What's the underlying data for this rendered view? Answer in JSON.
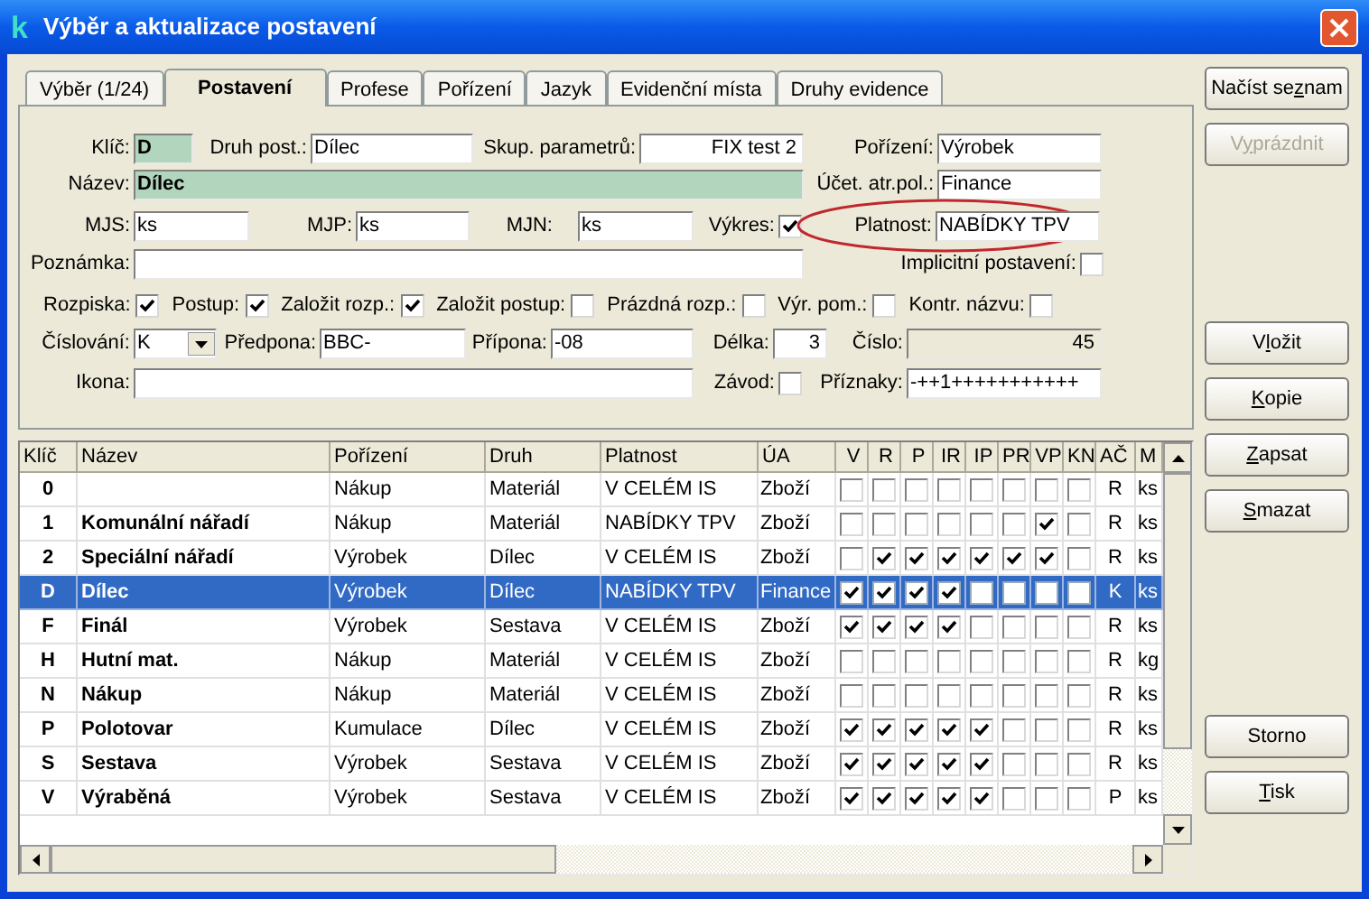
{
  "window": {
    "title": "Výběr a aktualizace postavení",
    "icon_letter": "k"
  },
  "tabs": [
    {
      "label": "Výběr (1/24)",
      "selected": false
    },
    {
      "label": "Postavení",
      "selected": true
    },
    {
      "label": "Profese",
      "selected": false
    },
    {
      "label": "Pořízení",
      "selected": false
    },
    {
      "label": "Jazyk",
      "selected": false
    },
    {
      "label": "Evidenční místa",
      "selected": false
    },
    {
      "label": "Druhy evidence",
      "selected": false
    }
  ],
  "form": {
    "klic": {
      "label": "Klíč:",
      "value": "D"
    },
    "druh_post": {
      "label": "Druh post.:",
      "value": "Dílec"
    },
    "skup_parametru": {
      "label": "Skup. parametrů:",
      "value": "FIX test 2"
    },
    "porizeni": {
      "label": "Pořízení:",
      "value": "Výrobek"
    },
    "nazev": {
      "label": "Název:",
      "value": "Dílec"
    },
    "ucet_atr_pol": {
      "label": "Účet. atr.pol.:",
      "value": "Finance"
    },
    "mjs": {
      "label": "MJS:",
      "value": "ks"
    },
    "mjp": {
      "label": "MJP:",
      "value": "ks"
    },
    "mjn": {
      "label": "MJN:",
      "value": "ks"
    },
    "vykres": {
      "label": "Výkres:",
      "checked": true
    },
    "platnost": {
      "label": "Platnost:",
      "value": "NABÍDKY TPV"
    },
    "poznamka": {
      "label": "Poznámka:"
    },
    "implicitni_postaveni": {
      "label": "Implicitní postavení:",
      "checked": false
    },
    "flags": [
      {
        "label": "Rozpiska:",
        "checked": true
      },
      {
        "label": "Postup:",
        "checked": true
      },
      {
        "label": "Založit rozp.:",
        "checked": true
      },
      {
        "label": "Založit postup:",
        "checked": false
      },
      {
        "label": "Prázdná rozp.:",
        "checked": false
      },
      {
        "label": "Výr. pom.:",
        "checked": false
      },
      {
        "label": "Kontr. názvu:",
        "checked": false
      }
    ],
    "cislovani": {
      "label": "Číslování:",
      "value": "K"
    },
    "predpona": {
      "label": "Předpona:",
      "value": "BBC-"
    },
    "pripona": {
      "label": "Přípona:",
      "value": "-08"
    },
    "delka": {
      "label": "Délka:",
      "value": "3"
    },
    "cislo": {
      "label": "Číslo:",
      "value": "45"
    },
    "ikona": {
      "label": "Ikona:"
    },
    "zavod": {
      "label": "Závod:",
      "checked": false
    },
    "priznaky": {
      "label": "Příznaky:",
      "value": "-++1+++++++++++"
    }
  },
  "table": {
    "columns": [
      "Klíč",
      "Název",
      "Pořízení",
      "Druh",
      "Platnost",
      "ÚA",
      "V",
      "R",
      "P",
      "IR",
      "IP",
      "PR",
      "VP",
      "KN",
      "AČ",
      "M"
    ],
    "rows": [
      {
        "key": "0",
        "porizeni": "Nákup",
        "druh": "Materiál",
        "platnost": "V CELÉM IS",
        "ua": "Zboží",
        "flags": [
          {
            "checked": false
          },
          {
            "checked": false
          },
          {
            "checked": false
          },
          {
            "checked": false
          },
          {
            "checked": false
          },
          {
            "checked": false
          },
          {
            "checked": false
          },
          {
            "checked": false
          }
        ],
        "ac": "R",
        "m": "ks",
        "selected": false
      },
      {
        "key": "1",
        "name": "Komunální nářadí",
        "porizeni": "Nákup",
        "druh": "Materiál",
        "platnost": "NABÍDKY TPV",
        "ua": "Zboží",
        "flags": [
          {
            "checked": false
          },
          {
            "checked": false
          },
          {
            "checked": false
          },
          {
            "checked": false
          },
          {
            "checked": false
          },
          {
            "checked": false
          },
          {
            "checked": true
          },
          {
            "checked": false
          }
        ],
        "ac": "R",
        "m": "ks",
        "selected": false
      },
      {
        "key": "2",
        "name": "Speciální nářadí",
        "porizeni": "Výrobek",
        "druh": "Dílec",
        "platnost": "V CELÉM IS",
        "ua": "Zboží",
        "flags": [
          {
            "checked": false
          },
          {
            "checked": true
          },
          {
            "checked": true
          },
          {
            "checked": true
          },
          {
            "checked": true
          },
          {
            "checked": true
          },
          {
            "checked": true
          },
          {
            "checked": false
          }
        ],
        "ac": "R",
        "m": "ks",
        "selected": false
      },
      {
        "key": "D",
        "name": "Dílec",
        "porizeni": "Výrobek",
        "druh": "Dílec",
        "platnost": "NABÍDKY TPV",
        "ua": "Finance",
        "flags": [
          {
            "checked": true
          },
          {
            "checked": true
          },
          {
            "checked": true
          },
          {
            "checked": true
          },
          {
            "checked": false
          },
          {
            "checked": false
          },
          {
            "checked": false
          },
          {
            "checked": false
          }
        ],
        "ac": "K",
        "m": "ks",
        "selected": true
      },
      {
        "key": "F",
        "name": "Finál",
        "porizeni": "Výrobek",
        "druh": "Sestava",
        "platnost": "V CELÉM IS",
        "ua": "Zboží",
        "flags": [
          {
            "checked": true
          },
          {
            "checked": true
          },
          {
            "checked": true
          },
          {
            "checked": true
          },
          {
            "checked": false
          },
          {
            "checked": false
          },
          {
            "checked": false
          },
          {
            "checked": false
          }
        ],
        "ac": "R",
        "m": "ks",
        "selected": false
      },
      {
        "key": "H",
        "name": "Hutní mat.",
        "porizeni": "Nákup",
        "druh": "Materiál",
        "platnost": "V CELÉM IS",
        "ua": "Zboží",
        "flags": [
          {
            "checked": false
          },
          {
            "checked": false
          },
          {
            "checked": false
          },
          {
            "checked": false
          },
          {
            "checked": false
          },
          {
            "checked": false
          },
          {
            "checked": false
          },
          {
            "checked": false
          }
        ],
        "ac": "R",
        "m": "kg",
        "selected": false
      },
      {
        "key": "N",
        "name": "Nákup",
        "porizeni": "Nákup",
        "druh": "Materiál",
        "platnost": "V CELÉM IS",
        "ua": "Zboží",
        "flags": [
          {
            "checked": false
          },
          {
            "checked": false
          },
          {
            "checked": false
          },
          {
            "checked": false
          },
          {
            "checked": false
          },
          {
            "checked": false
          },
          {
            "checked": false
          },
          {
            "checked": false
          }
        ],
        "ac": "R",
        "m": "ks",
        "selected": false
      },
      {
        "key": "P",
        "name": "Polotovar",
        "porizeni": "Kumulace",
        "druh": "Dílec",
        "platnost": "V CELÉM IS",
        "ua": "Zboží",
        "flags": [
          {
            "checked": true
          },
          {
            "checked": true
          },
          {
            "checked": true
          },
          {
            "checked": true
          },
          {
            "checked": true
          },
          {
            "checked": false
          },
          {
            "checked": false
          },
          {
            "checked": false
          }
        ],
        "ac": "R",
        "m": "ks",
        "selected": false
      },
      {
        "key": "S",
        "name": "Sestava",
        "porizeni": "Výrobek",
        "druh": "Sestava",
        "platnost": "V CELÉM IS",
        "ua": "Zboží",
        "flags": [
          {
            "checked": true
          },
          {
            "checked": true
          },
          {
            "checked": true
          },
          {
            "checked": true
          },
          {
            "checked": true
          },
          {
            "checked": false
          },
          {
            "checked": false
          },
          {
            "checked": false
          }
        ],
        "ac": "R",
        "m": "ks",
        "selected": false
      },
      {
        "key": "V",
        "name": "Výraběná",
        "porizeni": "Výrobek",
        "druh": "Sestava",
        "platnost": "V CELÉM IS",
        "ua": "Zboží",
        "flags": [
          {
            "checked": true
          },
          {
            "checked": true
          },
          {
            "checked": true
          },
          {
            "checked": true
          },
          {
            "checked": true
          },
          {
            "checked": false
          },
          {
            "checked": false
          },
          {
            "checked": false
          }
        ],
        "ac": "P",
        "m": "ks",
        "selected": false
      }
    ]
  },
  "buttons_top": [
    {
      "before": "Načíst se",
      "key": "z",
      "after": "nam",
      "disabled": false
    },
    {
      "before": "V",
      "key": "y",
      "after": "prázdnit",
      "disabled": true
    }
  ],
  "buttons_middle": [
    {
      "before": "V",
      "key": "l",
      "after": "ožit",
      "disabled": false
    },
    {
      "key": "K",
      "after": "opie",
      "disabled": false
    },
    {
      "key": "Z",
      "after": "apsat",
      "disabled": false
    },
    {
      "key": "S",
      "after": "mazat",
      "disabled": false
    }
  ],
  "buttons_bottom": [
    {
      "before": "Storno",
      "disabled": false
    },
    {
      "key": "T",
      "after": "isk",
      "disabled": false
    }
  ]
}
